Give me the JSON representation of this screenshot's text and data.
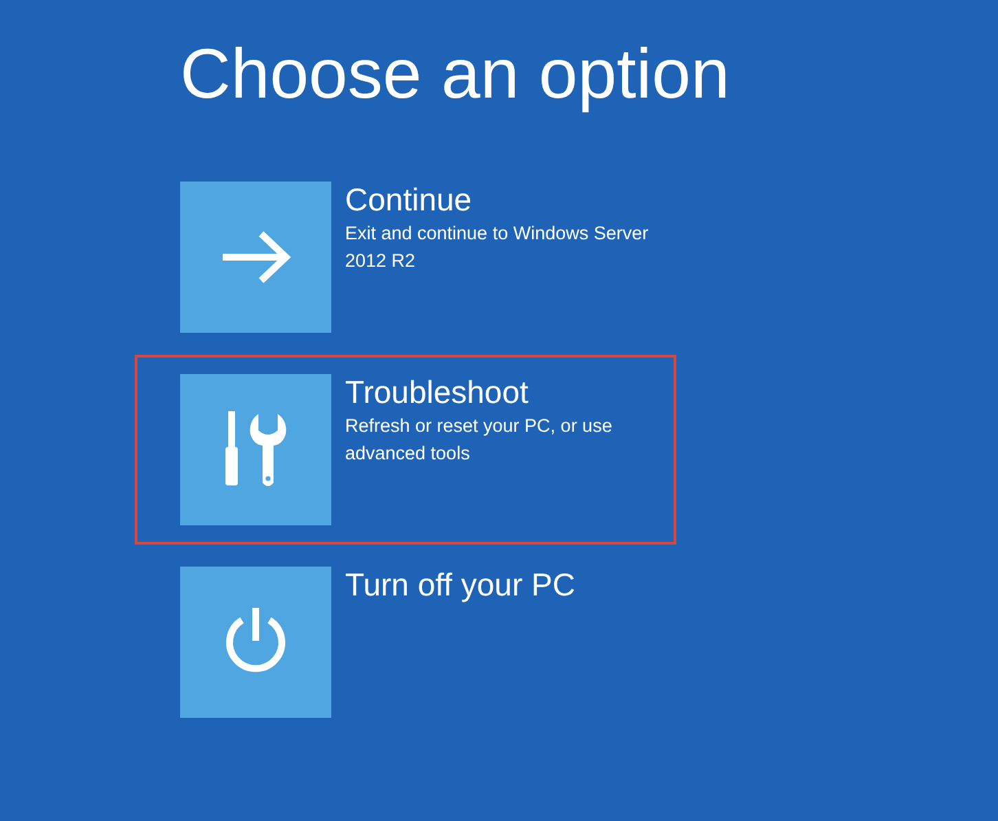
{
  "title": "Choose an option",
  "options": [
    {
      "kind": "continue",
      "label": "Continue",
      "description": "Exit and continue to Windows Server 2012 R2",
      "highlighted": false
    },
    {
      "kind": "troubleshoot",
      "label": "Troubleshoot",
      "description": "Refresh or reset your PC, or use advanced tools",
      "highlighted": true
    },
    {
      "kind": "power",
      "label": "Turn off your PC",
      "highlighted": false
    }
  ]
}
